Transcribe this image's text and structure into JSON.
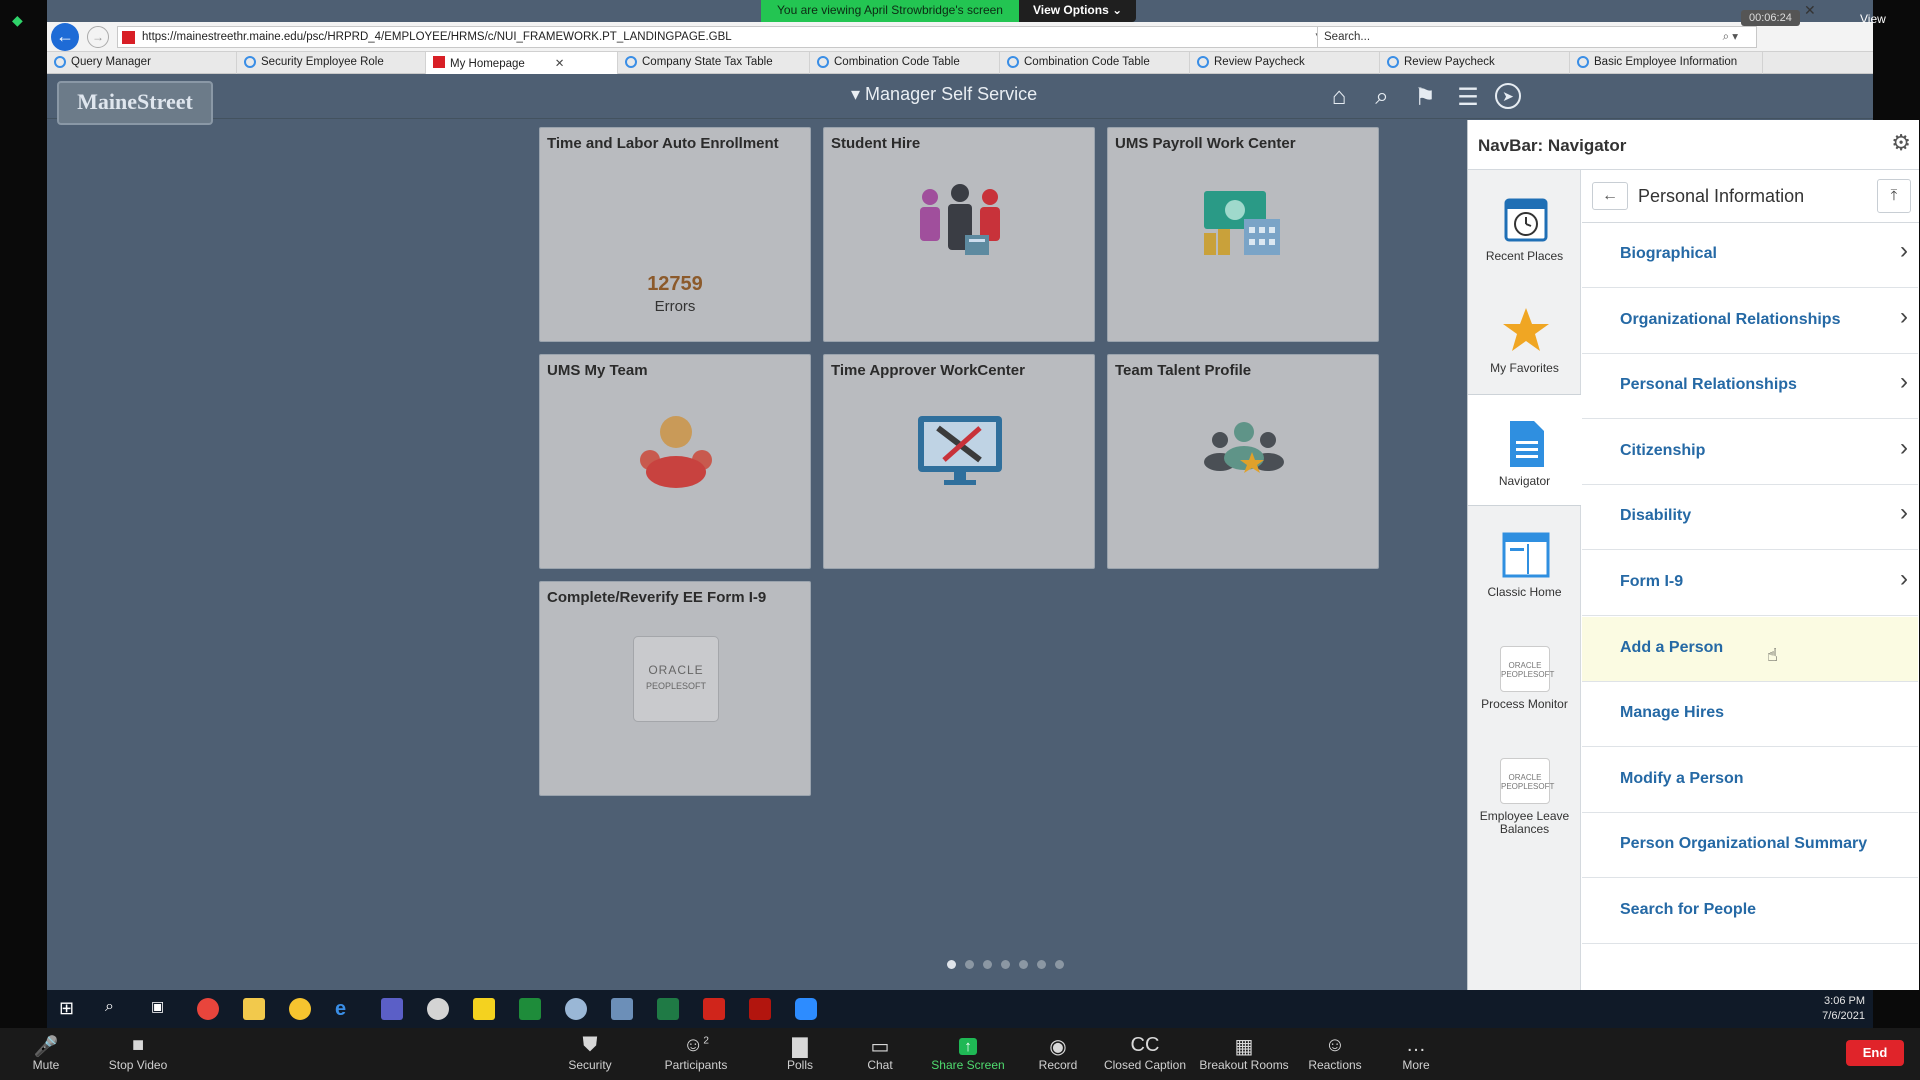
{
  "zoom_banner": {
    "viewing_text": "You are viewing April Strowbridge's screen",
    "view_options": "View Options"
  },
  "timer": "00:06:24",
  "view_label": "View",
  "browser": {
    "url": "https://mainestreethr.maine.edu/psc/HRPRD_4/EMPLOYEE/HRMS/c/NUI_FRAMEWORK.PT_LANDINGPAGE.GBL",
    "search_placeholder": "Search...",
    "tabs": [
      {
        "label": "Query Manager",
        "active": false
      },
      {
        "label": "Security Employee Role",
        "active": false
      },
      {
        "label": "My Homepage",
        "active": true
      },
      {
        "label": "Company State Tax Table",
        "active": false
      },
      {
        "label": "Combination Code Table",
        "active": false
      },
      {
        "label": "Combination Code Table",
        "active": false
      },
      {
        "label": "Review Paycheck",
        "active": false
      },
      {
        "label": "Review Paycheck",
        "active": false
      },
      {
        "label": "Basic Employee Information",
        "active": false
      }
    ]
  },
  "header": {
    "logo": "MaineStreet",
    "title": "Manager Self Service"
  },
  "tiles": [
    {
      "title": "Time and Labor Auto Enrollment",
      "count": "12759",
      "sub": "Errors"
    },
    {
      "title": "Student Hire"
    },
    {
      "title": "UMS Payroll Work Center"
    },
    {
      "title": "UMS My Team"
    },
    {
      "title": "Time Approver WorkCenter"
    },
    {
      "title": "Team Talent Profile"
    },
    {
      "title": "Complete/Reverify EE Form I-9",
      "badge": "ORACLE",
      "badge_sub": "PEOPLESOFT"
    }
  ],
  "pagination": {
    "pages": 7,
    "current": 1
  },
  "navbar": {
    "title": "NavBar: Navigator",
    "left_items": [
      {
        "label": "Recent Places",
        "icon": "calendar-clock-icon"
      },
      {
        "label": "My Favorites",
        "icon": "star-icon"
      },
      {
        "label": "Navigator",
        "icon": "document-icon",
        "selected": true
      },
      {
        "label": "Classic Home",
        "icon": "classic-home-icon"
      },
      {
        "label": "Process Monitor",
        "icon": "oracle-icon"
      },
      {
        "label": "Employee Leave Balances",
        "icon": "oracle-icon"
      }
    ],
    "section_title": "Personal Information",
    "items": [
      {
        "label": "Biographical",
        "chevron": true
      },
      {
        "label": "Organizational Relationships",
        "chevron": true
      },
      {
        "label": "Personal Relationships",
        "chevron": true
      },
      {
        "label": "Citizenship",
        "chevron": true
      },
      {
        "label": "Disability",
        "chevron": true
      },
      {
        "label": "Form I-9",
        "chevron": true
      },
      {
        "label": "Add a Person",
        "chevron": false
      },
      {
        "label": "Manage Hires",
        "chevron": false
      },
      {
        "label": "Modify a Person",
        "chevron": false
      },
      {
        "label": "Person Organizational Summary",
        "chevron": false
      },
      {
        "label": "Search for People",
        "chevron": false
      }
    ]
  },
  "taskbar": {
    "time": "3:06 PM",
    "date": "7/6/2021"
  },
  "zoom_controls": [
    {
      "label": "Mute",
      "icon": "mic-icon"
    },
    {
      "label": "Stop Video",
      "icon": "video-icon"
    },
    {
      "label": "Security",
      "icon": "shield-icon"
    },
    {
      "label": "Participants",
      "icon": "participants-icon",
      "count": "2"
    },
    {
      "label": "Polls",
      "icon": "polls-icon"
    },
    {
      "label": "Chat",
      "icon": "chat-icon"
    },
    {
      "label": "Share Screen",
      "icon": "share-screen-icon"
    },
    {
      "label": "Record",
      "icon": "record-icon"
    },
    {
      "label": "Closed Caption",
      "icon": "cc-icon"
    },
    {
      "label": "Breakout Rooms",
      "icon": "breakout-icon"
    },
    {
      "label": "Reactions",
      "icon": "reactions-icon"
    },
    {
      "label": "More",
      "icon": "more-icon"
    }
  ],
  "end_label": "End"
}
